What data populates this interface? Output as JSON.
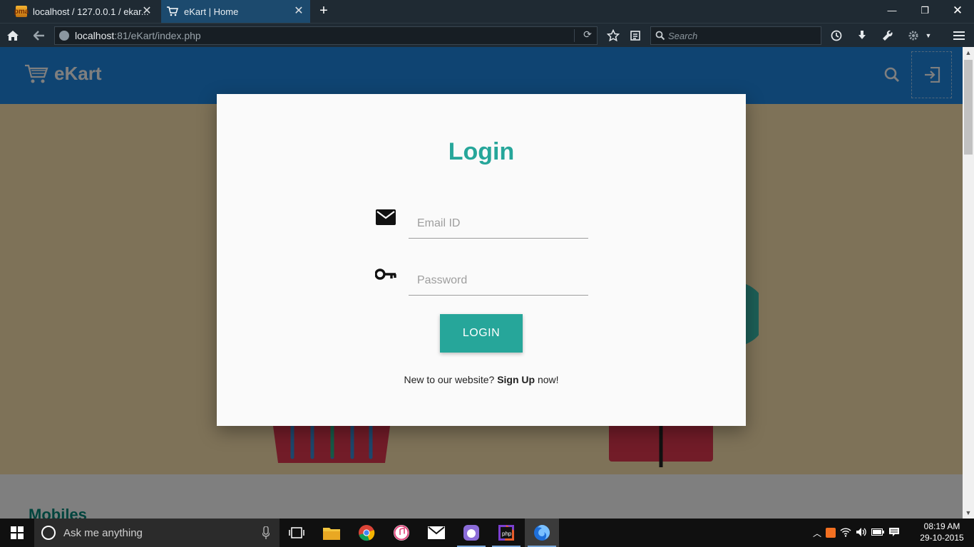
{
  "browser": {
    "tabs": [
      {
        "title": "localhost / 127.0.0.1 / ekar...",
        "favicon": "phpmyadmin-icon",
        "active": false
      },
      {
        "title": "eKart | Home",
        "favicon": "cart-icon",
        "active": true
      }
    ],
    "url": {
      "host": "localhost",
      "path": ":81/eKart/index.php"
    },
    "search_placeholder": "Search"
  },
  "site": {
    "brand": "eKart",
    "header_color": "#1e88e5",
    "slider": {
      "slides": 3,
      "active_slide": 2
    },
    "section_title": "Mobiles"
  },
  "login_modal": {
    "title": "Login",
    "email_placeholder": "Email ID",
    "password_placeholder": "Password",
    "button_label": "LOGIN",
    "signup_prefix": "New to our website?",
    "signup_link": "Sign Up",
    "signup_suffix": "now!",
    "accent_color": "#26a69a"
  },
  "taskbar": {
    "search_placeholder": "Ask me anything",
    "clock_time": "08:19 AM",
    "clock_date": "29-10-2015"
  }
}
